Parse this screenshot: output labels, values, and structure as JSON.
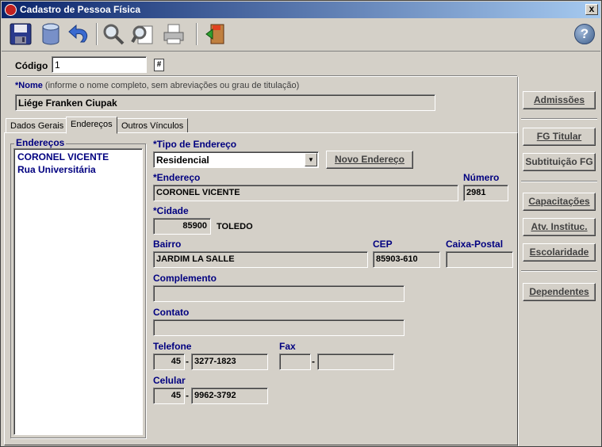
{
  "window": {
    "title": "Cadastro de Pessoa Física",
    "close": "x"
  },
  "toolbar": {
    "buttons": [
      "save-icon",
      "database-icon",
      "undo-icon",
      "search-icon",
      "search-document-icon",
      "print-icon",
      "exit-icon"
    ],
    "help": "?"
  },
  "codigo": {
    "label": "Código",
    "value": "1",
    "icon": "#"
  },
  "nome": {
    "label": "*Nome",
    "hint": "(informe o nome completo, sem abreviações ou grau de titulação)",
    "value": "Liége Franken Ciupak"
  },
  "tabs": [
    "Dados Gerais",
    "Endereços",
    "Outros Vínculos"
  ],
  "active_tab": "Endereços",
  "enderecos_list": {
    "label": "Endereços",
    "items": [
      "CORONEL VICENTE",
      "Rua Universitária"
    ]
  },
  "form": {
    "tipo_label": "*Tipo de Endereço",
    "tipo_value": "Residencial",
    "novo_endereco_btn": "Novo Endereço",
    "endereco_label": "*Endereço",
    "endereco_value": "CORONEL VICENTE",
    "numero_label": "Número",
    "numero_value": "2981",
    "cidade_label": "*Cidade",
    "cidade_code": "85900",
    "cidade_name": "TOLEDO",
    "bairro_label": "Bairro",
    "bairro_value": "JARDIM LA SALLE",
    "cep_label": "CEP",
    "cep_value": "85903-610",
    "caixa_postal_label": "Caixa-Postal",
    "caixa_postal_value": "",
    "complemento_label": "Complemento",
    "complemento_value": "",
    "contato_label": "Contato",
    "contato_value": "",
    "telefone_label": "Telefone",
    "telefone_ddd": "45",
    "telefone_num": "3277-1823",
    "fax_label": "Fax",
    "fax_ddd": "",
    "fax_num": "",
    "celular_label": "Celular",
    "celular_ddd": "45",
    "celular_num": "9962-3792",
    "dash": "-"
  },
  "side_buttons": {
    "admissoes": "Admissões",
    "fg_titular": "FG Titular",
    "substituicao_fg": "Subtituição FG",
    "capacitacoes": "Capacitações",
    "atv_instituc": "Atv. Instituc.",
    "escolaridade": "Escolaridade",
    "dependentes": "Dependentes"
  }
}
